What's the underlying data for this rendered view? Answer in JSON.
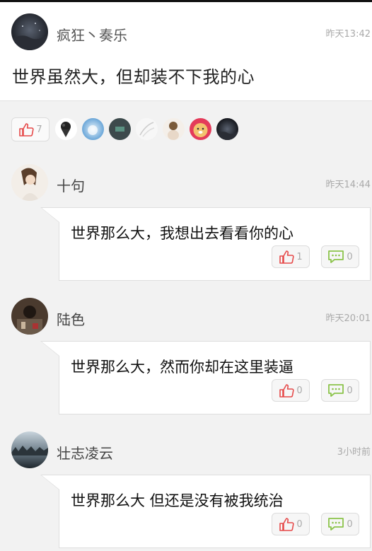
{
  "post": {
    "username": "疯狂丶奏乐",
    "time": "昨天13:42",
    "content": "世界虽然大，但却装不下我的心",
    "like_count": "7"
  },
  "comments": [
    {
      "username": "十句",
      "time": "昨天14:44",
      "text": "世界那么大，我想出去看看你的心",
      "likes": "1",
      "replies": "0"
    },
    {
      "username": "陆色",
      "time": "昨天20:01",
      "text": "世界那么大，然而你却在这里装逼",
      "likes": "0",
      "replies": "0"
    },
    {
      "username": "壮志凌云",
      "time": "3小时前",
      "text": "世界那么大 但还是没有被我统治",
      "likes": "0",
      "replies": "0"
    }
  ],
  "colors": {
    "like_red": "#e64a4a",
    "reply_green": "#8bc34a"
  },
  "icons": {
    "like": "thumbs-up-icon",
    "reply": "speech-bubble-icon"
  }
}
